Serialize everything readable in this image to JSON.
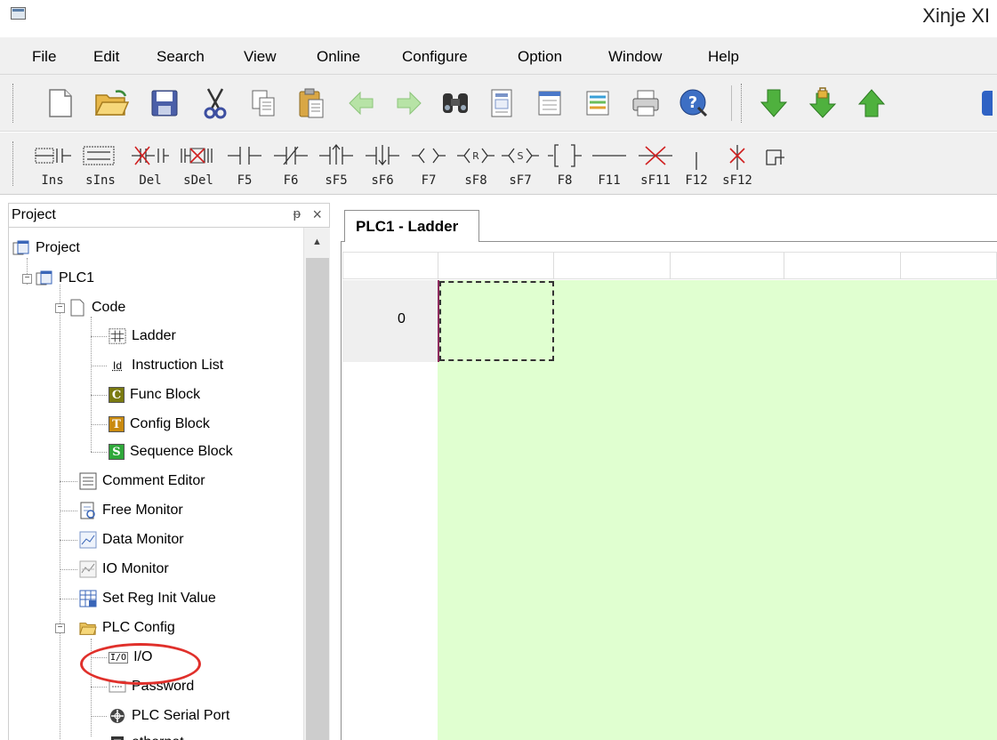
{
  "window": {
    "title": "Xinje XI"
  },
  "menu": [
    "File",
    "Edit",
    "Search",
    "View",
    "Online",
    "Configure",
    "Option",
    "Window",
    "Help"
  ],
  "toolbar": {
    "file_icons": [
      "new-file-icon",
      "open-folder-icon",
      "save-icon",
      "cut-icon",
      "copy-icon",
      "paste-icon",
      "back-arrow-icon",
      "forward-arrow-icon",
      "find-icon",
      "compile-icon",
      "window-icon",
      "list-icon",
      "print-icon",
      "help-icon"
    ],
    "plc_icons": [
      "download-icon",
      "secure-download-icon",
      "upload-icon"
    ]
  },
  "ladder_toolbar": [
    {
      "label": "Ins",
      "icon": "insert-icon"
    },
    {
      "label": "sIns",
      "icon": "shift-insert-icon"
    },
    {
      "label": "Del",
      "icon": "delete-icon"
    },
    {
      "label": "sDel",
      "icon": "shift-delete-icon"
    },
    {
      "label": "F5",
      "icon": "no-contact-icon"
    },
    {
      "label": "F6",
      "icon": "nc-contact-icon"
    },
    {
      "label": "sF5",
      "icon": "rising-edge-icon"
    },
    {
      "label": "sF6",
      "icon": "falling-edge-icon"
    },
    {
      "label": "F7",
      "icon": "coil-icon"
    },
    {
      "label": "sF8",
      "icon": "reset-coil-icon"
    },
    {
      "label": "sF7",
      "icon": "set-coil-icon"
    },
    {
      "label": "F8",
      "icon": "instruction-icon"
    },
    {
      "label": "F11",
      "icon": "horizontal-line-icon"
    },
    {
      "label": "sF11",
      "icon": "delete-horizontal-line-icon"
    },
    {
      "label": "F12",
      "icon": "vertical-line-icon"
    },
    {
      "label": "sF12",
      "icon": "delete-vertical-line-icon"
    }
  ],
  "project_panel": {
    "title": "Project",
    "pin": "ᵽ",
    "close": "×",
    "tree": {
      "root": "Project",
      "plc": "PLC1",
      "code": "Code",
      "ladder": "Ladder",
      "instruction_list": "Instruction List",
      "func_block": "Func Block",
      "config_block": "Config Block",
      "sequence_block": "Sequence Block",
      "comment_editor": "Comment Editor",
      "free_monitor": "Free Monitor",
      "data_monitor": "Data Monitor",
      "io_monitor": "IO Monitor",
      "set_reg": "Set Reg Init Value",
      "plc_config": "PLC Config",
      "io": "I/O",
      "password": "Password",
      "serial_port": "PLC Serial Port",
      "ethernet": "ethernet"
    },
    "icon_glyphs": {
      "instruction_list": "Id",
      "func_block": "C",
      "config_block": "T",
      "sequence_block": "S",
      "io": "I/O"
    }
  },
  "editor": {
    "tab": "PLC1 - Ladder",
    "row_number": "0",
    "background": "#e0ffd0",
    "highlight_color": "#e0302b"
  }
}
